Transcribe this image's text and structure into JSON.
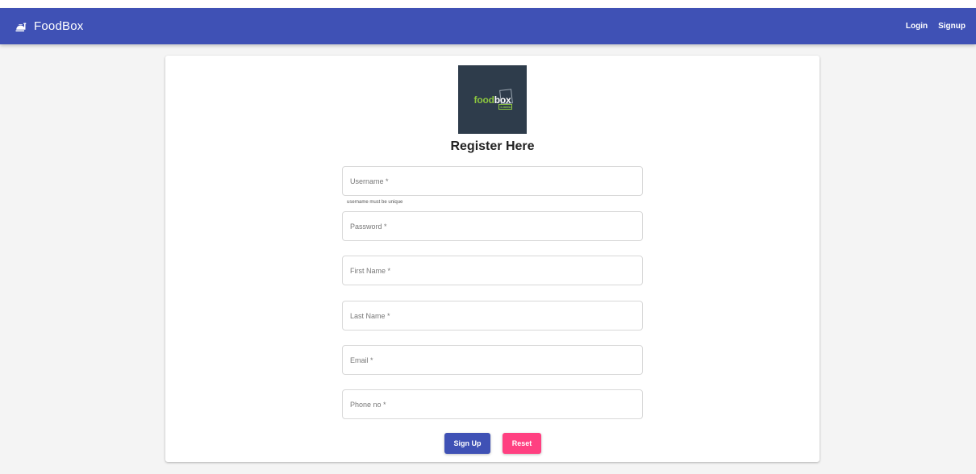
{
  "navbar": {
    "brand_title": "FoodBox",
    "brand_icon": "food-tray-icon",
    "links": {
      "login": "Login",
      "signup": "Signup"
    }
  },
  "logo": {
    "food": "food",
    "box": "box",
    "sub": "e-menu"
  },
  "form": {
    "title": "Register Here",
    "fields": {
      "username": {
        "placeholder": "Username *",
        "value": "",
        "hint": "username must be unique"
      },
      "password": {
        "placeholder": "Password *",
        "value": ""
      },
      "first_name": {
        "placeholder": "First Name *",
        "value": ""
      },
      "last_name": {
        "placeholder": "Last Name *",
        "value": ""
      },
      "email": {
        "placeholder": "Email *",
        "value": ""
      },
      "phone": {
        "placeholder": "Phone no *",
        "value": ""
      }
    },
    "buttons": {
      "signup": "Sign Up",
      "reset": "Reset"
    }
  },
  "colors": {
    "primary": "#3f51b5",
    "accent": "#ff4081",
    "logo_bg": "#2e3c4b",
    "logo_green": "#8cc63f"
  }
}
